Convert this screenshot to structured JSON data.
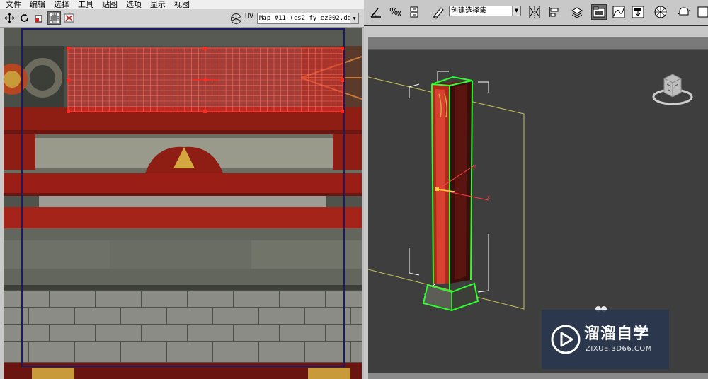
{
  "uv_editor": {
    "menu": [
      "文件",
      "编辑",
      "选择",
      "工具",
      "贴图",
      "选项",
      "显示",
      "视图"
    ],
    "uv_label": "UV",
    "map_select": {
      "value": "Map #11  (cs2_fy_ez002.dd:"
    }
  },
  "main_toolbar": {
    "selection_set": {
      "value": "创建选择集"
    }
  },
  "watermark": {
    "title": "溜溜自学",
    "url": "ZIXUE.3D66.COM"
  },
  "axis_labels": {
    "y": "y",
    "x": "x"
  },
  "colors": {
    "selection_red": "#e8322c",
    "selection_green": "#2cff2c",
    "gizmo_yellow": "#c9c25a",
    "pillar_red": "#9a1b12"
  }
}
